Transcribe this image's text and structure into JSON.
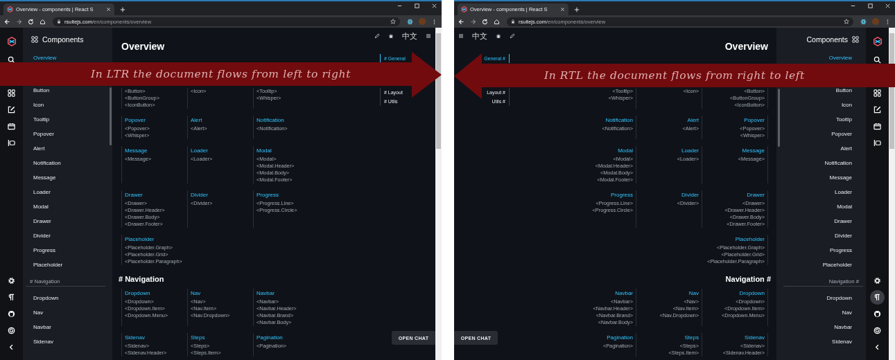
{
  "windows": [
    {
      "rtl": false,
      "rtl_toggle_on": false,
      "browser": {
        "tab_title": "Overview - components | React S",
        "url_host": "rsuitejs.com",
        "url_path": "/en/components/overview"
      },
      "lang_link": "中文",
      "sidebar": {
        "title": "Components",
        "items": [
          {
            "kind": "item",
            "label": "Overview",
            "selected": true
          },
          {
            "kind": "item",
            "label": "Button",
            "selected": false
          },
          {
            "kind": "item",
            "label": "Icon",
            "selected": false
          },
          {
            "kind": "item",
            "label": "Tooltip",
            "selected": false
          },
          {
            "kind": "item",
            "label": "Popover",
            "selected": false
          },
          {
            "kind": "item",
            "label": "Alert",
            "selected": false
          },
          {
            "kind": "item",
            "label": "Notification",
            "selected": false
          },
          {
            "kind": "item",
            "label": "Message",
            "selected": false
          },
          {
            "kind": "item",
            "label": "Loader",
            "selected": false
          },
          {
            "kind": "item",
            "label": "Modal",
            "selected": false
          },
          {
            "kind": "item",
            "label": "Drawer",
            "selected": false
          },
          {
            "kind": "item",
            "label": "Divider",
            "selected": false
          },
          {
            "kind": "item",
            "label": "Progress",
            "selected": false
          },
          {
            "kind": "item",
            "label": "Placeholder",
            "selected": false
          },
          {
            "kind": "group",
            "label": "# Navigation"
          },
          {
            "kind": "item",
            "label": "Dropdown",
            "selected": false
          },
          {
            "kind": "item",
            "label": "Nav",
            "selected": false
          },
          {
            "kind": "item",
            "label": "Navbar",
            "selected": false
          },
          {
            "kind": "item",
            "label": "Sidenav",
            "selected": false
          }
        ]
      },
      "page_title": "Overview",
      "toc": [
        {
          "label": "# General",
          "selected": true
        },
        {
          "label": "# Layout",
          "selected": false
        },
        {
          "label": "# Utils",
          "selected": false
        }
      ],
      "blocks": [
        {
          "kind": "cards",
          "cards": [
            {
              "tags": [
                "<Button>",
                "<ButtonGroup>",
                "<IconButton>"
              ]
            },
            {
              "tags": [
                "<Icon>"
              ]
            },
            {
              "tags": [
                "<Tooltip>",
                "<Whisper>"
              ]
            }
          ]
        },
        {
          "kind": "cards",
          "cards": [
            {
              "title": "Popover",
              "tags": [
                "<Popover>",
                "<Whisper>"
              ]
            },
            {
              "title": "Alert",
              "tags": [
                "<Alert>"
              ]
            },
            {
              "title": "Notification",
              "tags": [
                "<Notification>"
              ]
            }
          ]
        },
        {
          "kind": "cards",
          "cards": [
            {
              "title": "Message",
              "tags": [
                "<Message>"
              ]
            },
            {
              "title": "Loader",
              "tags": [
                "<Loader>"
              ]
            },
            {
              "title": "Modal",
              "tags": [
                "<Modal>",
                "<Modal.Header>",
                "<Modal.Body>",
                "<Modal.Footer>"
              ]
            }
          ]
        },
        {
          "kind": "cards",
          "cards": [
            {
              "title": "Drawer",
              "tags": [
                "<Drawer>",
                "<Drawer.Header>",
                "<Drawer.Body>",
                "<Drawer.Footer>"
              ]
            },
            {
              "title": "Divider",
              "tags": [
                "<Divider>"
              ]
            },
            {
              "title": "Progress",
              "tags": [
                "<Progress.Line>",
                "<Progress.Circle>"
              ]
            }
          ]
        },
        {
          "kind": "cards",
          "cards": [
            {
              "title": "Placeholder",
              "tags": [
                "<Placeholder.Graph>",
                "<Placeholder.Grid>",
                "<Placeholder.Paragraph>"
              ]
            }
          ]
        },
        {
          "kind": "heading",
          "text": "# Navigation"
        },
        {
          "kind": "cards",
          "cards": [
            {
              "title": "Dropdown",
              "tags": [
                "<Dropdown>",
                "<Dropdown.Item>",
                "<Dropdown.Menu>"
              ]
            },
            {
              "title": "Nav",
              "tags": [
                "<Nav>",
                "<Nav.Item>",
                "<Nav.Dropdown>"
              ]
            },
            {
              "title": "Navbar",
              "tags": [
                "<Navbar>",
                "<Navbar.Header>",
                "<Navbar.Brand>",
                "<Navbar.Body>"
              ]
            }
          ]
        },
        {
          "kind": "cards",
          "cards": [
            {
              "title": "Sidenav",
              "tags": [
                "<Sidenav>",
                "<Sidenav.Header>"
              ]
            },
            {
              "title": "Steps",
              "tags": [
                "<Steps>",
                "<Steps.Item>"
              ]
            },
            {
              "title": "Pagination",
              "tags": [
                "<Pagination>"
              ]
            }
          ]
        }
      ],
      "chat_button": "OPEN CHAT",
      "annotation": {
        "text": "In LTR the document flows from left to right"
      }
    },
    {
      "rtl": true,
      "rtl_toggle_on": true,
      "browser": {
        "tab_title": "Overview - components | React S",
        "url_host": "rsuitejs.com",
        "url_path": "/en/components/overview"
      },
      "lang_link": "中文",
      "sidebar": {
        "title": "Components",
        "items": [
          {
            "kind": "item",
            "label": "Overview",
            "selected": true
          },
          {
            "kind": "item",
            "label": "Button",
            "selected": false
          },
          {
            "kind": "item",
            "label": "Icon",
            "selected": false
          },
          {
            "kind": "item",
            "label": "Tooltip",
            "selected": false
          },
          {
            "kind": "item",
            "label": "Popover",
            "selected": false
          },
          {
            "kind": "item",
            "label": "Alert",
            "selected": false
          },
          {
            "kind": "item",
            "label": "Notification",
            "selected": false
          },
          {
            "kind": "item",
            "label": "Message",
            "selected": false
          },
          {
            "kind": "item",
            "label": "Loader",
            "selected": false
          },
          {
            "kind": "item",
            "label": "Modal",
            "selected": false
          },
          {
            "kind": "item",
            "label": "Drawer",
            "selected": false
          },
          {
            "kind": "item",
            "label": "Divider",
            "selected": false
          },
          {
            "kind": "item",
            "label": "Progress",
            "selected": false
          },
          {
            "kind": "item",
            "label": "Placeholder",
            "selected": false
          },
          {
            "kind": "group",
            "label": "Navigation #"
          },
          {
            "kind": "item",
            "label": "Dropdown",
            "selected": false
          },
          {
            "kind": "item",
            "label": "Nav",
            "selected": false
          },
          {
            "kind": "item",
            "label": "Navbar",
            "selected": false
          },
          {
            "kind": "item",
            "label": "Sidenav",
            "selected": false
          }
        ]
      },
      "page_title": "Overview",
      "toc": [
        {
          "label": "General #",
          "selected": true
        },
        {
          "label": "Layout #",
          "selected": false
        },
        {
          "label": "Utils #",
          "selected": false
        }
      ],
      "blocks": [
        {
          "kind": "cards",
          "cards": [
            {
              "tags": [
                "<Tooltip>",
                "<Whisper>"
              ]
            },
            {
              "tags": [
                "<Icon>"
              ]
            },
            {
              "tags": [
                "<Button>",
                "<ButtonGroup>",
                "<IconButton>"
              ]
            }
          ]
        },
        {
          "kind": "cards",
          "cards": [
            {
              "title": "Notification",
              "tags": [
                "<Notification>"
              ]
            },
            {
              "title": "Alert",
              "tags": [
                "<Alert>"
              ]
            },
            {
              "title": "Popover",
              "tags": [
                "<Popover>",
                "<Whisper>"
              ]
            }
          ]
        },
        {
          "kind": "cards",
          "cards": [
            {
              "title": "Modal",
              "tags": [
                "<Modal>",
                "<Modal.Header>",
                "<Modal.Body>",
                "<Modal.Footer>"
              ]
            },
            {
              "title": "Loader",
              "tags": [
                "<Loader>"
              ]
            },
            {
              "title": "Message",
              "tags": [
                "<Message>"
              ]
            }
          ]
        },
        {
          "kind": "cards",
          "cards": [
            {
              "title": "Progress",
              "tags": [
                "<Progress.Line>",
                "<Progress.Circle>"
              ]
            },
            {
              "title": "Divider",
              "tags": [
                "<Divider>"
              ]
            },
            {
              "title": "Drawer",
              "tags": [
                "<Drawer>",
                "<Drawer.Header>",
                "<Drawer.Body>",
                "<Drawer.Footer>"
              ]
            }
          ]
        },
        {
          "kind": "cards",
          "cards": [
            {
              "title": "Placeholder",
              "tags": [
                "<Placeholder.Graph>",
                "<Placeholder.Grid>",
                "<Placeholder.Paragraph>"
              ]
            }
          ]
        },
        {
          "kind": "heading",
          "text": "Navigation #"
        },
        {
          "kind": "cards",
          "cards": [
            {
              "title": "Navbar",
              "tags": [
                "<Navbar>",
                "<Navbar.Header>",
                "<Navbar.Brand>",
                "<Navbar.Body>"
              ]
            },
            {
              "title": "Nav",
              "tags": [
                "<Nav>",
                "<Nav.Item>",
                "<Nav.Dropdown>"
              ]
            },
            {
              "title": "Dropdown",
              "tags": [
                "<Dropdown>",
                "<Dropdown.Item>",
                "<Dropdown.Menu>"
              ]
            }
          ]
        },
        {
          "kind": "cards",
          "cards": [
            {
              "title": "Pagination",
              "tags": [
                "<Pagination>"
              ]
            },
            {
              "title": "Steps",
              "tags": [
                "<Steps>",
                "<Steps.Item>"
              ]
            },
            {
              "title": "Sidenav",
              "tags": [
                "<Sidenav>",
                "<Sidenav.Header>"
              ]
            }
          ]
        }
      ],
      "chat_button": "OPEN CHAT",
      "annotation": {
        "text": "In RTL the document flows from right to left"
      }
    }
  ]
}
